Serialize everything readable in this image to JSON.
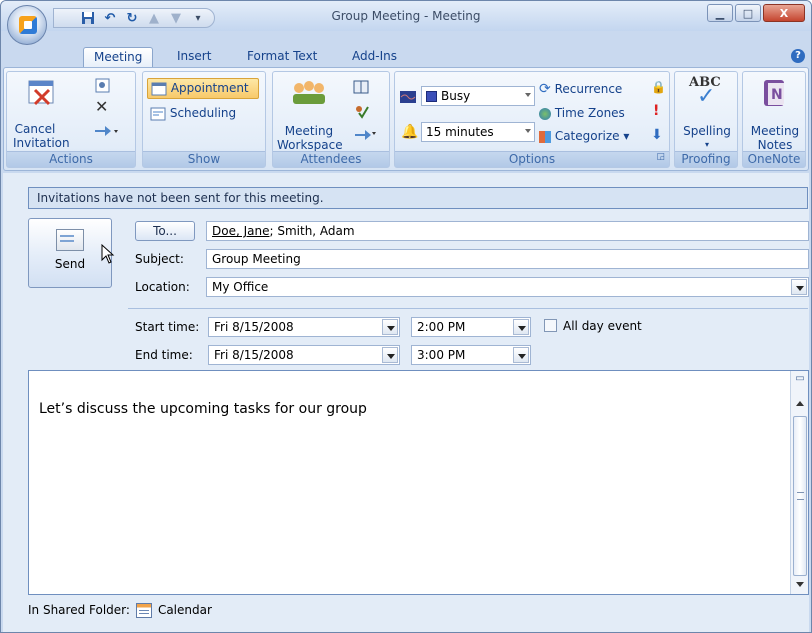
{
  "window": {
    "title": "Group Meeting - Meeting"
  },
  "ribbon_tabs": [
    "Meeting",
    "Insert",
    "Format Text",
    "Add-Ins"
  ],
  "ribbon": {
    "actions": {
      "cancel_label_1": "Cancel",
      "cancel_label_2": "Invitation",
      "group": "Actions"
    },
    "show": {
      "appointment": "Appointment",
      "scheduling": "Scheduling",
      "group": "Show"
    },
    "attendees": {
      "workspace_1": "Meeting",
      "workspace_2": "Workspace",
      "group": "Attendees"
    },
    "options": {
      "show_as": "Busy",
      "reminder": "15 minutes",
      "recurrence": "Recurrence",
      "time_zones": "Time Zones",
      "categorize": "Categorize",
      "group": "Options"
    },
    "proofing": {
      "spelling": "Spelling",
      "abc": "ABC",
      "group": "Proofing"
    },
    "onenote": {
      "notes_1": "Meeting",
      "notes_2": "Notes",
      "group": "OneNote"
    }
  },
  "info_bar": "Invitations have not been sent for this meeting.",
  "send_label": "Send",
  "form": {
    "to_button": "To...",
    "to_first": "Doe, Jane",
    "to_rest": "; Smith, Adam",
    "subject_label": "Subject:",
    "subject": "Group Meeting",
    "location_label": "Location:",
    "location": "My Office",
    "start_label": "Start time:",
    "start_date": "Fri 8/15/2008",
    "start_time": "2:00 PM",
    "end_label": "End time:",
    "end_date": "Fri 8/15/2008",
    "end_time": "3:00 PM",
    "all_day": "All day event"
  },
  "body_text": "Let’s discuss the upcoming tasks for our group",
  "status": {
    "label": "In Shared Folder:",
    "folder": "Calendar"
  }
}
